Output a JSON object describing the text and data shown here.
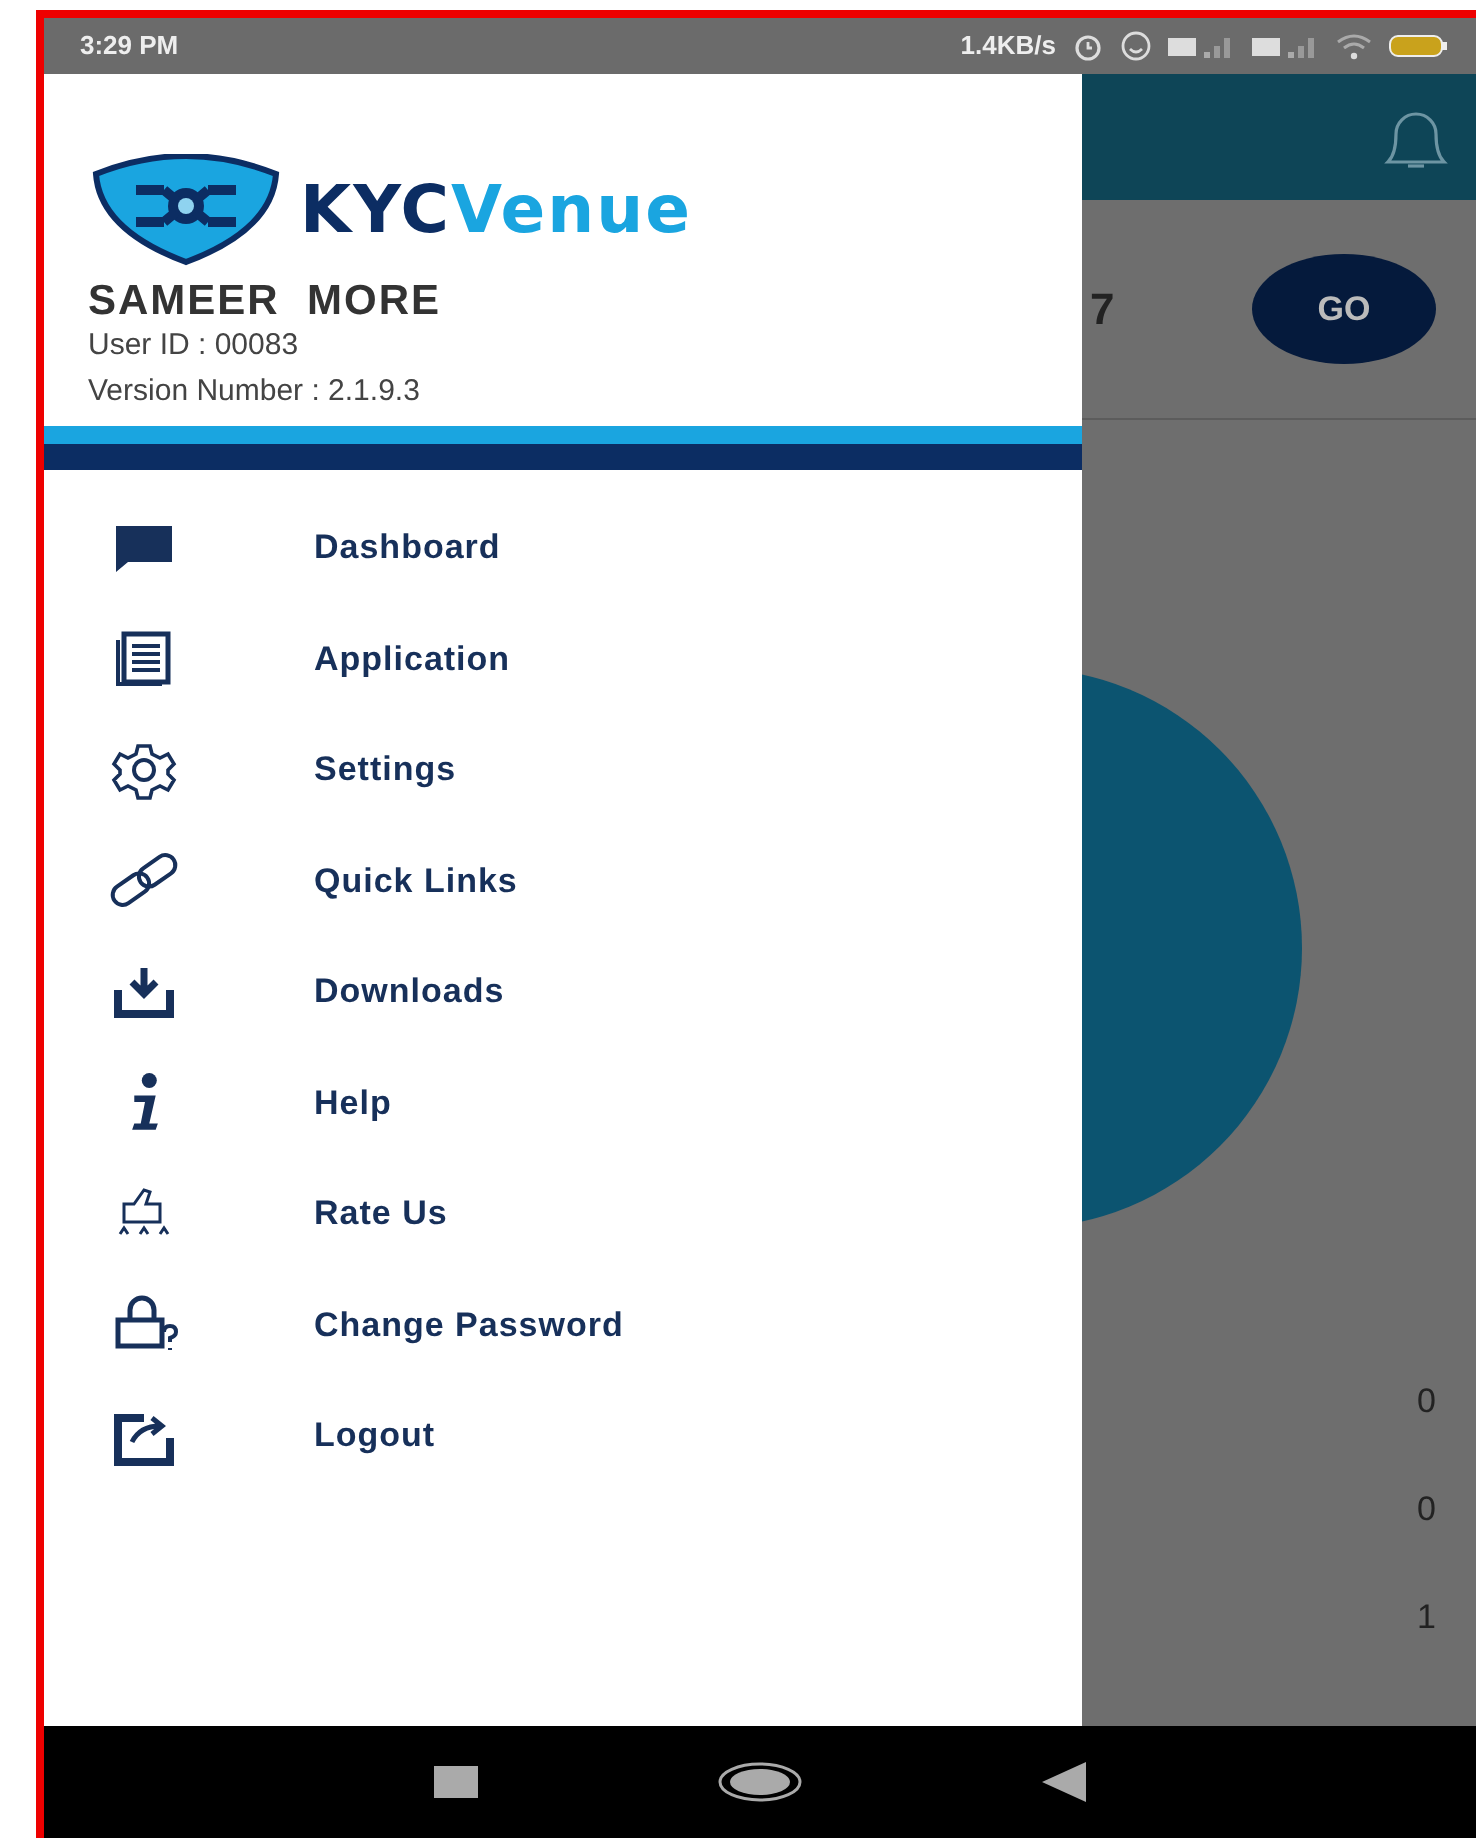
{
  "status_bar": {
    "time": "3:29 PM",
    "net_speed": "1.4KB/s"
  },
  "drawer": {
    "logo": {
      "part_1": "KYC",
      "part_2": "Venue"
    },
    "user_name": "SAMEER  MORE",
    "user_id": "User ID : 00083",
    "version": "Version Number : 2.1.9.3",
    "menu": [
      {
        "label": "Dashboard",
        "kind": "chat"
      },
      {
        "label": "Application",
        "kind": "document"
      },
      {
        "label": "Settings",
        "kind": "gear"
      },
      {
        "label": "Quick Links",
        "kind": "link"
      },
      {
        "label": "Downloads",
        "kind": "download"
      },
      {
        "label": "Help",
        "kind": "info"
      },
      {
        "label": "Rate Us",
        "kind": "rate"
      },
      {
        "label": "Change Password",
        "kind": "lock"
      },
      {
        "label": "Logout",
        "kind": "logout"
      }
    ]
  },
  "background_app": {
    "partial_text": "7",
    "go_button": "GO",
    "values": [
      "0",
      "0",
      "1"
    ]
  }
}
